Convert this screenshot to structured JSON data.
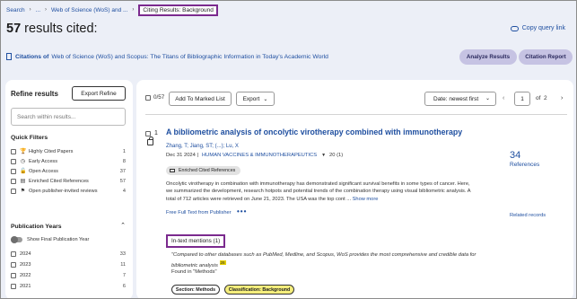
{
  "breadcrumb": {
    "search": "Search",
    "ellipsis": "...",
    "wos": "Web of Science (WoS) and ...",
    "current": "Citing Results: Background"
  },
  "header": {
    "count": "57",
    "title_suffix": "results cited:",
    "copy_query": "Copy query link"
  },
  "citations": {
    "prefix": "Citations of",
    "text": "Web of Science (WoS) and Scopus: The Titans of Bibliographic Information in Today's Academic World"
  },
  "actions": {
    "analyze": "Analyze Results",
    "citation_report": "Citation Report"
  },
  "refine": {
    "title": "Refine results",
    "export": "Export Refine",
    "search_placeholder": "Search within results...",
    "quick_filters_title": "Quick Filters",
    "quick_filters": [
      {
        "icon": "trophy-icon",
        "glyph": "🏆",
        "label": "Highly Cited Papers",
        "count": "1"
      },
      {
        "icon": "clock-icon",
        "glyph": "◷",
        "label": "Early Access",
        "count": "8"
      },
      {
        "icon": "open-lock-icon",
        "glyph": "🔓",
        "label": "Open Access",
        "count": "37"
      },
      {
        "icon": "enriched-icon",
        "glyph": "▤",
        "label": "Enriched Cited References",
        "count": "57"
      },
      {
        "icon": "flag-icon",
        "glyph": "⚑",
        "label": "Open publisher-invited reviews",
        "count": "4"
      }
    ],
    "pub_years_title": "Publication Years",
    "final_pub_toggle": "Show Final Publication Year",
    "years": [
      {
        "label": "2024",
        "count": "33"
      },
      {
        "label": "2023",
        "count": "11"
      },
      {
        "label": "2022",
        "count": "7"
      },
      {
        "label": "2021",
        "count": "6"
      }
    ]
  },
  "toolbar": {
    "selected": "0/57",
    "add_marked": "Add To Marked List",
    "export": "Export",
    "sort": "Date: newest first",
    "page_current": "1",
    "page_of": "of",
    "page_total": "2"
  },
  "record": {
    "number": "1",
    "title": "A bibliometric analysis of oncolytic virotherapy combined with immunotherapy",
    "authors": "Zhang, T; Jiang, ST; (...); Lu, X",
    "date": "Dec 31 2024",
    "journal": "HUMAN VACCINES & IMMUNOTHERAPEUTICS",
    "issue": "20 (1)",
    "badge": "Enriched Cited References",
    "abstract": "Oncolytic virotherapy in combination with immunotherapy has demonstrated significant survival benefits in some types of cancer. Here, we summarized the development, research hotpots and potential trends of the combination therapy using visual bibliometric analysis. A total of 712 articles were retrieved on June 21, 2023. The USA was the top cont ...",
    "show_more": "Show more",
    "full_text": "Free Full Text from Publisher",
    "more_dots": "•••",
    "citations_count": "34",
    "citations_label": "References",
    "related": "Related records",
    "intext_label": "In-text mentions (1)",
    "quote": "\"Compared to other databases such as PubMed, Medline, and Scopus, WoS provides the most comprehensive and credible data for bibliometric analysis",
    "quote_marker": "26",
    "found_in": "Found in \"Methods\"",
    "section_tag": "Section: Methods",
    "classification_tag": "Classification: Background"
  }
}
